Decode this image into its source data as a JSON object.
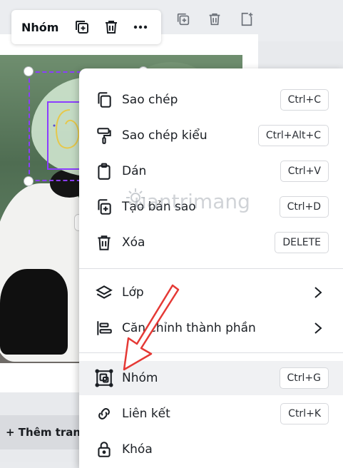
{
  "float_toolbar": {
    "label": "Nhóm",
    "icons": [
      "copy-plus-icon",
      "trash-icon",
      "more-icon"
    ]
  },
  "background_toolbar": {
    "icons": [
      "copy-plus-icon",
      "trash-icon",
      "add-page-icon"
    ]
  },
  "add_page_button": "+ Thêm tran",
  "watermark_text": "uantrimang",
  "context_menu": {
    "items": [
      {
        "icon": "copy-icon",
        "label": "Sao chép",
        "shortcut": "Ctrl+C"
      },
      {
        "icon": "paint-roller-icon",
        "label": "Sao chép kiểu",
        "shortcut": "Ctrl+Alt+C"
      },
      {
        "icon": "clipboard-icon",
        "label": "Dán",
        "shortcut": "Ctrl+V"
      },
      {
        "icon": "duplicate-icon",
        "label": "Tạo bản sao",
        "shortcut": "Ctrl+D"
      },
      {
        "icon": "trash-icon",
        "label": "Xóa",
        "shortcut": "DELETE"
      },
      {
        "icon": "layers-icon",
        "label": "Lớp",
        "shortcut": ""
      },
      {
        "icon": "align-icon",
        "label": "Căn chỉnh thành phần",
        "shortcut": ""
      },
      {
        "icon": "group-icon",
        "label": "Nhóm",
        "shortcut": "Ctrl+G"
      },
      {
        "icon": "link-icon",
        "label": "Liên kết",
        "shortcut": "Ctrl+K"
      },
      {
        "icon": "lock-icon",
        "label": "Khóa",
        "shortcut": ""
      }
    ]
  },
  "colors": {
    "accent": "#8b3dff",
    "arrow": "#e53935"
  }
}
